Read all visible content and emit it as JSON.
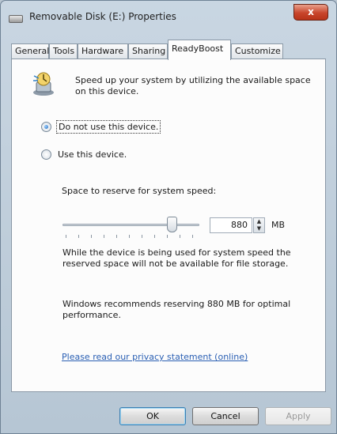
{
  "window": {
    "title": "Removable Disk (E:) Properties",
    "close_glyph": "x"
  },
  "tabs": [
    {
      "label": "General"
    },
    {
      "label": "Tools"
    },
    {
      "label": "Hardware"
    },
    {
      "label": "Sharing"
    },
    {
      "label": "ReadyBoost"
    },
    {
      "label": "Customize"
    }
  ],
  "active_tab": "ReadyBoost",
  "readyboost": {
    "intro": "Speed up your system by utilizing the available space on this device.",
    "option_do_not_use": "Do not use this device.",
    "option_use": "Use this device.",
    "selected_option": "Do not use this device.",
    "reserve_label": "Space to reserve for system speed:",
    "reserve_value": "880",
    "reserve_unit": "MB",
    "slider_fraction": 0.82,
    "warning_text": "While the device is being used for system speed the reserved space will not be available for file storage.",
    "recommendation_text": "Windows recommends reserving 880 MB for optimal performance.",
    "privacy_link": "Please read our privacy statement (online)"
  },
  "buttons": {
    "ok": "OK",
    "cancel": "Cancel",
    "apply": "Apply"
  }
}
